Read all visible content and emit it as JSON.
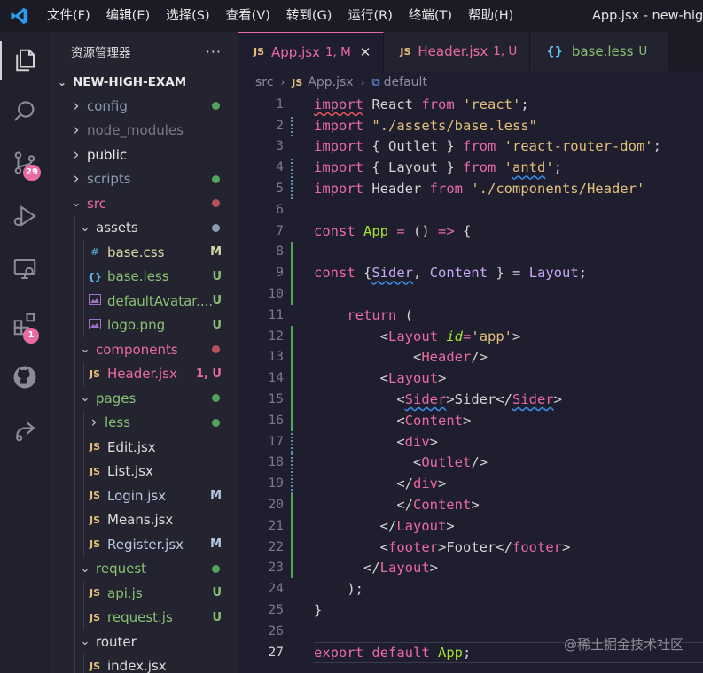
{
  "window": {
    "menu": [
      "文件(F)",
      "编辑(E)",
      "选择(S)",
      "查看(V)",
      "转到(G)",
      "运行(R)",
      "终端(T)",
      "帮助(H)"
    ],
    "title": "App.jsx - new-high"
  },
  "activity_bar": {
    "items": [
      {
        "name": "explorer",
        "icon": "files-icon"
      },
      {
        "name": "search",
        "icon": "search-icon"
      },
      {
        "name": "source-control",
        "icon": "source-control-icon",
        "badge": "29"
      },
      {
        "name": "run-debug",
        "icon": "debug-icon"
      },
      {
        "name": "remote",
        "icon": "remote-explorer-icon"
      },
      {
        "name": "extensions",
        "icon": "extensions-icon",
        "badge": "1"
      },
      {
        "name": "github",
        "icon": "github-icon"
      },
      {
        "name": "live-share",
        "icon": "share-icon"
      }
    ]
  },
  "sidebar": {
    "title": "资源管理器",
    "more": "···",
    "root": "NEW-HIGH-EXAM",
    "tree": [
      {
        "label": "config",
        "type": "folder",
        "open": false,
        "depth": 1,
        "color": "#8b9bb0",
        "dot": "#52a35c"
      },
      {
        "label": "node_modules",
        "type": "folder",
        "open": false,
        "depth": 1,
        "color": "#7a7a88"
      },
      {
        "label": "public",
        "type": "folder",
        "open": false,
        "depth": 1,
        "color": "#e8e8e8"
      },
      {
        "label": "scripts",
        "type": "folder",
        "open": false,
        "depth": 1,
        "color": "#8b9bb0",
        "dot": "#52a35c"
      },
      {
        "label": "src",
        "type": "folder",
        "open": true,
        "depth": 1,
        "color": "#ea6aa6",
        "dot": "#b3525f"
      },
      {
        "label": "assets",
        "type": "folder",
        "open": true,
        "depth": 2,
        "color": "#dcdcdc",
        "dot": "#8b9bb0"
      },
      {
        "label": "base.css",
        "type": "file",
        "icon": "#",
        "icon_color": "#519aba",
        "depth": 3,
        "color": "#d8d8a8",
        "status": "M",
        "status_color": "#d8d8a8"
      },
      {
        "label": "base.less",
        "type": "file",
        "icon": "{}",
        "icon_color": "#5ec2f5",
        "depth": 3,
        "color": "#88c074",
        "status": "U",
        "status_color": "#88c074"
      },
      {
        "label": "defaultAvatar....",
        "type": "file",
        "icon": "img",
        "icon_color": "#a074c4",
        "depth": 3,
        "color": "#88c074",
        "status": "U",
        "status_color": "#88c074"
      },
      {
        "label": "logo.png",
        "type": "file",
        "icon": "img",
        "icon_color": "#a074c4",
        "depth": 3,
        "color": "#88c074",
        "status": "U",
        "status_color": "#88c074"
      },
      {
        "label": "components",
        "type": "folder",
        "open": true,
        "depth": 2,
        "color": "#ea6aa6",
        "dot": "#b3525f"
      },
      {
        "label": "Header.jsx",
        "type": "file",
        "icon": "JS",
        "icon_color": "#e5c07b",
        "depth": 3,
        "color": "#ea6aa6",
        "status": "1, U",
        "status_color": "#ea6aa6"
      },
      {
        "label": "pages",
        "type": "folder",
        "open": true,
        "depth": 2,
        "color": "#88c074",
        "dot": "#52a35c"
      },
      {
        "label": "less",
        "type": "folder",
        "open": false,
        "depth": 3,
        "color": "#88c074",
        "dot": "#52a35c"
      },
      {
        "label": "Edit.jsx",
        "type": "file",
        "icon": "JS",
        "icon_color": "#e5c07b",
        "depth": 3,
        "color": "#dcdcdc"
      },
      {
        "label": "List.jsx",
        "type": "file",
        "icon": "JS",
        "icon_color": "#e5c07b",
        "depth": 3,
        "color": "#dcdcdc"
      },
      {
        "label": "Login.jsx",
        "type": "file",
        "icon": "JS",
        "icon_color": "#e5c07b",
        "depth": 3,
        "color": "#b9c7e0",
        "status": "M",
        "status_color": "#b9c7e0"
      },
      {
        "label": "Means.jsx",
        "type": "file",
        "icon": "JS",
        "icon_color": "#e5c07b",
        "depth": 3,
        "color": "#dcdcdc"
      },
      {
        "label": "Register.jsx",
        "type": "file",
        "icon": "JS",
        "icon_color": "#e5c07b",
        "depth": 3,
        "color": "#b9c7e0",
        "status": "M",
        "status_color": "#b9c7e0"
      },
      {
        "label": "request",
        "type": "folder",
        "open": true,
        "depth": 2,
        "color": "#88c074",
        "dot": "#52a35c"
      },
      {
        "label": "api.js",
        "type": "file",
        "icon": "JS",
        "icon_color": "#e5c07b",
        "depth": 3,
        "color": "#88c074",
        "status": "U",
        "status_color": "#88c074"
      },
      {
        "label": "request.js",
        "type": "file",
        "icon": "JS",
        "icon_color": "#e5c07b",
        "depth": 3,
        "color": "#88c074",
        "status": "U",
        "status_color": "#88c074"
      },
      {
        "label": "router",
        "type": "folder",
        "open": true,
        "depth": 2,
        "color": "#dcdcdc"
      },
      {
        "label": "index.jsx",
        "type": "file",
        "icon": "JS",
        "icon_color": "#e5c07b",
        "depth": 3,
        "color": "#dcdcdc"
      }
    ]
  },
  "tabs": [
    {
      "icon": "JS",
      "label": "App.jsx",
      "status": "1, M",
      "active": true,
      "color": "#ea6aa6",
      "close": "✕"
    },
    {
      "icon": "JS",
      "label": "Header.jsx",
      "status": "1, U",
      "active": false,
      "color": "#ea6aa6"
    },
    {
      "icon": "{}",
      "label": "base.less",
      "status": "U",
      "active": false,
      "color": "#88c074"
    }
  ],
  "breadcrumb": {
    "folder": "src",
    "file": "App.jsx",
    "symbol": "default"
  },
  "editor": {
    "current_line": 27,
    "lines": [
      {
        "n": 1,
        "gutter": "",
        "tokens": [
          [
            "k sqr",
            "import"
          ],
          [
            "p",
            " React "
          ],
          [
            "k",
            "from"
          ],
          [
            "p",
            " "
          ],
          [
            "s",
            "'react'"
          ],
          [
            "p",
            ";"
          ]
        ]
      },
      {
        "n": 2,
        "gutter": "modified",
        "tokens": [
          [
            "k",
            "import"
          ],
          [
            "p",
            " "
          ],
          [
            "s",
            "\"./assets/base.less\""
          ]
        ]
      },
      {
        "n": 3,
        "gutter": "",
        "tokens": [
          [
            "k",
            "import"
          ],
          [
            "p",
            " { Outlet } "
          ],
          [
            "k",
            "from"
          ],
          [
            "p",
            " "
          ],
          [
            "s",
            "'react-router-dom'"
          ],
          [
            "p",
            ";"
          ]
        ]
      },
      {
        "n": 4,
        "gutter": "modified",
        "tokens": [
          [
            "k",
            "import"
          ],
          [
            "p",
            " { Layout } "
          ],
          [
            "k",
            "from"
          ],
          [
            "p",
            " "
          ],
          [
            "s",
            "'"
          ],
          [
            "s sq",
            "antd"
          ],
          [
            "s",
            "'"
          ],
          [
            "p",
            ";"
          ]
        ]
      },
      {
        "n": 5,
        "gutter": "modified",
        "tokens": [
          [
            "k",
            "import"
          ],
          [
            "p",
            " Header "
          ],
          [
            "k",
            "from"
          ],
          [
            "p",
            " "
          ],
          [
            "s",
            "'./components/Header'"
          ]
        ]
      },
      {
        "n": 6,
        "gutter": "",
        "tokens": []
      },
      {
        "n": 7,
        "gutter": "",
        "tokens": [
          [
            "k",
            "const"
          ],
          [
            "p",
            " "
          ],
          [
            "f",
            "App"
          ],
          [
            "p",
            " "
          ],
          [
            "k",
            "="
          ],
          [
            "p",
            " () "
          ],
          [
            "k",
            "=>"
          ],
          [
            "p",
            " {"
          ]
        ]
      },
      {
        "n": 8,
        "gutter": "added",
        "tokens": []
      },
      {
        "n": 9,
        "gutter": "added",
        "tokens": [
          [
            "k",
            "const"
          ],
          [
            "p",
            " {"
          ],
          [
            "c sq",
            "Sider"
          ],
          [
            "p",
            ", "
          ],
          [
            "c",
            "Content"
          ],
          [
            "p",
            " } = "
          ],
          [
            "c",
            "Layout"
          ],
          [
            "p",
            ";"
          ]
        ]
      },
      {
        "n": 10,
        "gutter": "added",
        "tokens": []
      },
      {
        "n": 11,
        "gutter": "",
        "tokens": [
          [
            "p",
            "    "
          ],
          [
            "k",
            "return"
          ],
          [
            "p",
            " ("
          ]
        ]
      },
      {
        "n": 12,
        "gutter": "added",
        "tokens": [
          [
            "p",
            "        <"
          ],
          [
            "t",
            "Layout"
          ],
          [
            "p",
            " "
          ],
          [
            "a",
            "id"
          ],
          [
            "k",
            "="
          ],
          [
            "s",
            "'app'"
          ],
          [
            "p",
            ">"
          ]
        ]
      },
      {
        "n": 13,
        "gutter": "added",
        "tokens": [
          [
            "p",
            "            <"
          ],
          [
            "t",
            "Header"
          ],
          [
            "p",
            "/>"
          ]
        ]
      },
      {
        "n": 14,
        "gutter": "added",
        "tokens": [
          [
            "p",
            "        <"
          ],
          [
            "t",
            "Layout"
          ],
          [
            "p",
            ">"
          ]
        ]
      },
      {
        "n": 15,
        "gutter": "added",
        "tokens": [
          [
            "p",
            "          <"
          ],
          [
            "t sq",
            "Sider"
          ],
          [
            "p",
            ">Sider</"
          ],
          [
            "t sq",
            "Sider"
          ],
          [
            "p",
            ">"
          ]
        ]
      },
      {
        "n": 16,
        "gutter": "added",
        "tokens": [
          [
            "p",
            "          <"
          ],
          [
            "t",
            "Content"
          ],
          [
            "p",
            ">"
          ]
        ]
      },
      {
        "n": 17,
        "gutter": "modified",
        "tokens": [
          [
            "p",
            "          <"
          ],
          [
            "t",
            "div"
          ],
          [
            "p",
            ">"
          ]
        ]
      },
      {
        "n": 18,
        "gutter": "modified",
        "tokens": [
          [
            "p",
            "            <"
          ],
          [
            "t",
            "Outlet"
          ],
          [
            "p",
            "/>"
          ]
        ]
      },
      {
        "n": 19,
        "gutter": "modified",
        "tokens": [
          [
            "p",
            "          </"
          ],
          [
            "t",
            "div"
          ],
          [
            "p",
            ">"
          ]
        ]
      },
      {
        "n": 20,
        "gutter": "added",
        "tokens": [
          [
            "p",
            "          </"
          ],
          [
            "t",
            "Content"
          ],
          [
            "p",
            ">"
          ]
        ]
      },
      {
        "n": 21,
        "gutter": "added",
        "tokens": [
          [
            "p",
            "        </"
          ],
          [
            "t",
            "Layout"
          ],
          [
            "p",
            ">"
          ]
        ]
      },
      {
        "n": 22,
        "gutter": "added",
        "tokens": [
          [
            "p",
            "        <"
          ],
          [
            "t",
            "footer"
          ],
          [
            "p",
            ">Footer</"
          ],
          [
            "t",
            "footer"
          ],
          [
            "p",
            ">"
          ]
        ]
      },
      {
        "n": 23,
        "gutter": "added",
        "tokens": [
          [
            "p",
            "      </"
          ],
          [
            "t",
            "Layout"
          ],
          [
            "p",
            ">"
          ]
        ]
      },
      {
        "n": 24,
        "gutter": "",
        "tokens": [
          [
            "p",
            "    );"
          ]
        ]
      },
      {
        "n": 25,
        "gutter": "",
        "tokens": [
          [
            "p",
            "}"
          ]
        ]
      },
      {
        "n": 26,
        "gutter": "",
        "tokens": []
      },
      {
        "n": 27,
        "gutter": "",
        "tokens": [
          [
            "k",
            "export"
          ],
          [
            "p",
            " "
          ],
          [
            "k",
            "default"
          ],
          [
            "p",
            " "
          ],
          [
            "f",
            "App"
          ],
          [
            "p",
            ";"
          ]
        ]
      }
    ]
  },
  "watermark": "@稀土掘金技术社区",
  "colors": {
    "accent": "#ea6aa6",
    "added": "#52a35c",
    "modified": "#5b8fb0"
  }
}
